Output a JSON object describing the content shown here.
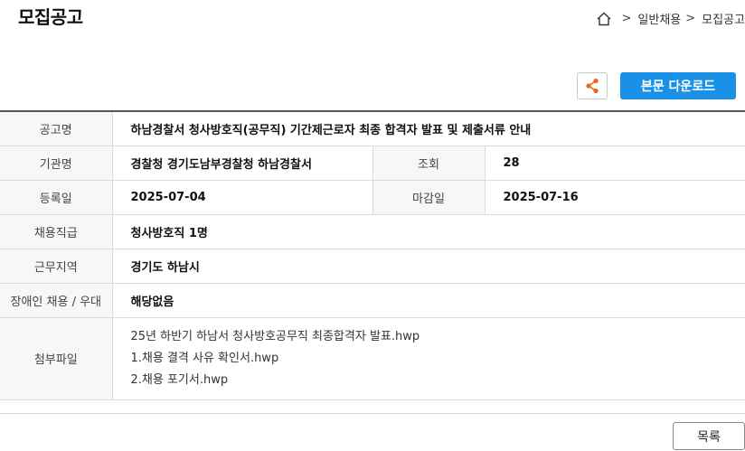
{
  "header": {
    "title": "모집공고",
    "breadcrumb": {
      "sep1": ">",
      "item1": "일반채용",
      "sep2": ">",
      "item2": "모집공고"
    }
  },
  "actions": {
    "download_label": "본문 다운로드"
  },
  "info": {
    "title_label": "공고명",
    "title_value": "하남경찰서 청사방호직(공무직) 기간제근로자 최종 합격자 발표 및 제출서류 안내",
    "org_label": "기관명",
    "org_value": "경찰청 경기도남부경찰청 하남경찰서",
    "views_label": "조회",
    "views_value": "28",
    "reg_label": "등록일",
    "reg_value": "2025-07-04",
    "deadline_label": "마감일",
    "deadline_value": "2025-07-16",
    "position_label": "채용직급",
    "position_value": "청사방호직 1명",
    "location_label": "근무지역",
    "location_value": "경기도 하남시",
    "disability_label": "장애인 채용 / 우대",
    "disability_value": "해당없음",
    "files_label": "첨부파일",
    "files": [
      "25년 하반기 하남서 청사방호공무직 최종합격자 발표.hwp",
      "1.채용 결격 사유 확인서.hwp",
      "2.채용 포기서.hwp"
    ]
  },
  "footer": {
    "list_label": "목록"
  },
  "colors": {
    "accent": "#1a91e6",
    "share_icon": "#e8651a"
  }
}
